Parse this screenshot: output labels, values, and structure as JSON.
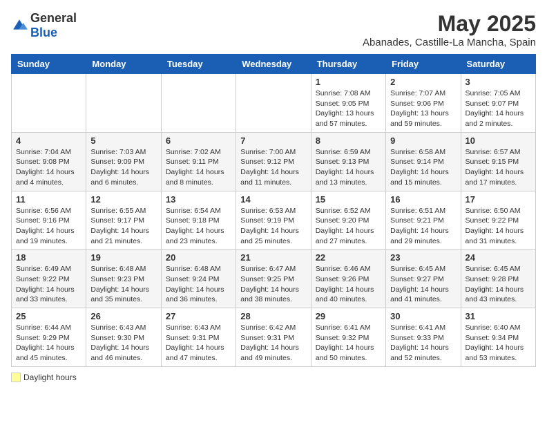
{
  "logo": {
    "general": "General",
    "blue": "Blue"
  },
  "title": "May 2025",
  "location": "Abanades, Castille-La Mancha, Spain",
  "days_of_week": [
    "Sunday",
    "Monday",
    "Tuesday",
    "Wednesday",
    "Thursday",
    "Friday",
    "Saturday"
  ],
  "weeks": [
    [
      {
        "day": "",
        "info": ""
      },
      {
        "day": "",
        "info": ""
      },
      {
        "day": "",
        "info": ""
      },
      {
        "day": "",
        "info": ""
      },
      {
        "day": "1",
        "info": "Sunrise: 7:08 AM\nSunset: 9:05 PM\nDaylight: 13 hours and 57 minutes."
      },
      {
        "day": "2",
        "info": "Sunrise: 7:07 AM\nSunset: 9:06 PM\nDaylight: 13 hours and 59 minutes."
      },
      {
        "day": "3",
        "info": "Sunrise: 7:05 AM\nSunset: 9:07 PM\nDaylight: 14 hours and 2 minutes."
      }
    ],
    [
      {
        "day": "4",
        "info": "Sunrise: 7:04 AM\nSunset: 9:08 PM\nDaylight: 14 hours and 4 minutes."
      },
      {
        "day": "5",
        "info": "Sunrise: 7:03 AM\nSunset: 9:09 PM\nDaylight: 14 hours and 6 minutes."
      },
      {
        "day": "6",
        "info": "Sunrise: 7:02 AM\nSunset: 9:11 PM\nDaylight: 14 hours and 8 minutes."
      },
      {
        "day": "7",
        "info": "Sunrise: 7:00 AM\nSunset: 9:12 PM\nDaylight: 14 hours and 11 minutes."
      },
      {
        "day": "8",
        "info": "Sunrise: 6:59 AM\nSunset: 9:13 PM\nDaylight: 14 hours and 13 minutes."
      },
      {
        "day": "9",
        "info": "Sunrise: 6:58 AM\nSunset: 9:14 PM\nDaylight: 14 hours and 15 minutes."
      },
      {
        "day": "10",
        "info": "Sunrise: 6:57 AM\nSunset: 9:15 PM\nDaylight: 14 hours and 17 minutes."
      }
    ],
    [
      {
        "day": "11",
        "info": "Sunrise: 6:56 AM\nSunset: 9:16 PM\nDaylight: 14 hours and 19 minutes."
      },
      {
        "day": "12",
        "info": "Sunrise: 6:55 AM\nSunset: 9:17 PM\nDaylight: 14 hours and 21 minutes."
      },
      {
        "day": "13",
        "info": "Sunrise: 6:54 AM\nSunset: 9:18 PM\nDaylight: 14 hours and 23 minutes."
      },
      {
        "day": "14",
        "info": "Sunrise: 6:53 AM\nSunset: 9:19 PM\nDaylight: 14 hours and 25 minutes."
      },
      {
        "day": "15",
        "info": "Sunrise: 6:52 AM\nSunset: 9:20 PM\nDaylight: 14 hours and 27 minutes."
      },
      {
        "day": "16",
        "info": "Sunrise: 6:51 AM\nSunset: 9:21 PM\nDaylight: 14 hours and 29 minutes."
      },
      {
        "day": "17",
        "info": "Sunrise: 6:50 AM\nSunset: 9:22 PM\nDaylight: 14 hours and 31 minutes."
      }
    ],
    [
      {
        "day": "18",
        "info": "Sunrise: 6:49 AM\nSunset: 9:22 PM\nDaylight: 14 hours and 33 minutes."
      },
      {
        "day": "19",
        "info": "Sunrise: 6:48 AM\nSunset: 9:23 PM\nDaylight: 14 hours and 35 minutes."
      },
      {
        "day": "20",
        "info": "Sunrise: 6:48 AM\nSunset: 9:24 PM\nDaylight: 14 hours and 36 minutes."
      },
      {
        "day": "21",
        "info": "Sunrise: 6:47 AM\nSunset: 9:25 PM\nDaylight: 14 hours and 38 minutes."
      },
      {
        "day": "22",
        "info": "Sunrise: 6:46 AM\nSunset: 9:26 PM\nDaylight: 14 hours and 40 minutes."
      },
      {
        "day": "23",
        "info": "Sunrise: 6:45 AM\nSunset: 9:27 PM\nDaylight: 14 hours and 41 minutes."
      },
      {
        "day": "24",
        "info": "Sunrise: 6:45 AM\nSunset: 9:28 PM\nDaylight: 14 hours and 43 minutes."
      }
    ],
    [
      {
        "day": "25",
        "info": "Sunrise: 6:44 AM\nSunset: 9:29 PM\nDaylight: 14 hours and 45 minutes."
      },
      {
        "day": "26",
        "info": "Sunrise: 6:43 AM\nSunset: 9:30 PM\nDaylight: 14 hours and 46 minutes."
      },
      {
        "day": "27",
        "info": "Sunrise: 6:43 AM\nSunset: 9:31 PM\nDaylight: 14 hours and 47 minutes."
      },
      {
        "day": "28",
        "info": "Sunrise: 6:42 AM\nSunset: 9:31 PM\nDaylight: 14 hours and 49 minutes."
      },
      {
        "day": "29",
        "info": "Sunrise: 6:41 AM\nSunset: 9:32 PM\nDaylight: 14 hours and 50 minutes."
      },
      {
        "day": "30",
        "info": "Sunrise: 6:41 AM\nSunset: 9:33 PM\nDaylight: 14 hours and 52 minutes."
      },
      {
        "day": "31",
        "info": "Sunrise: 6:40 AM\nSunset: 9:34 PM\nDaylight: 14 hours and 53 minutes."
      }
    ]
  ],
  "legend": {
    "label": "Daylight hours"
  }
}
